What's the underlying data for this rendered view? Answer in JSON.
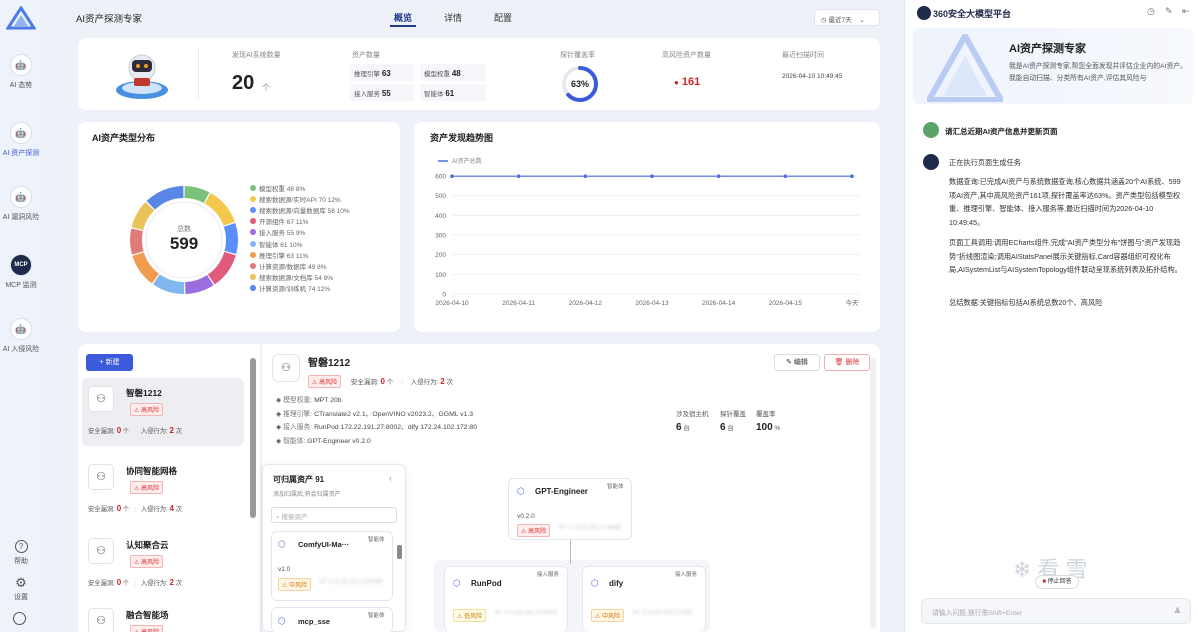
{
  "app": {
    "title": "AI资产探测专家"
  },
  "tabs": [
    {
      "label": "概览"
    },
    {
      "label": "详情"
    },
    {
      "label": "配置"
    }
  ],
  "time_filter": "最近7天",
  "nav": {
    "items": [
      {
        "label": "AI 态势"
      },
      {
        "label": "AI 资产探测"
      },
      {
        "label": "AI 漏洞风险"
      },
      {
        "label": "MCP 监测"
      },
      {
        "label": "AI 入侵风险"
      }
    ],
    "help": "帮助",
    "settings": "设置"
  },
  "stats": {
    "discovered_label": "发现AI系统数量",
    "discovered_value": "20",
    "discovered_unit": "个",
    "assets_label": "资产数量",
    "engine_label": "推理引擎",
    "engine_value": "63",
    "model_label": "模型权重",
    "model_value": "48",
    "access_label": "接入服务",
    "access_value": "55",
    "agent_label": "智能体",
    "agent_value": "61",
    "coverage_label": "探针覆盖率",
    "coverage_value": "63%",
    "coverage_fraction": 0.63,
    "high_risk_label": "高风险资产数量",
    "high_risk_value": "161",
    "scan_label": "最近扫描时间",
    "scan_value": "2026-04-10 10:49:45"
  },
  "donut": {
    "title": "AI资产类型分布",
    "center_label": "总数",
    "center_value": "599"
  },
  "trend": {
    "title": "资产发现趋势图"
  },
  "chart_data": [
    {
      "type": "pie",
      "title": "AI资产类型分布",
      "labels": [
        "模型权重 48 8%",
        "搜索数据源/实时API 70 12%",
        "搜索数据源/向量数据库 58 10%",
        "开源组件 67 11%",
        "接入服务 55 9%",
        "智能体 61 10%",
        "推理引擎 63 11%",
        "计算资源/数据库 49 8%",
        "搜索数据源/文档库 54 9%",
        "计算资源/训练机 74 12%"
      ],
      "values": [
        48,
        70,
        58,
        67,
        55,
        61,
        63,
        49,
        54,
        74
      ],
      "colors": [
        "#7ac17a",
        "#f2c94c",
        "#5b8ff9",
        "#e05a7b",
        "#9b6ee0",
        "#7fb8ef",
        "#f09b50",
        "#e07b7b",
        "#e8c35a",
        "#5a86e6"
      ]
    },
    {
      "type": "line",
      "title": "资产发现趋势图",
      "x": [
        "2026-04-10",
        "2026-04-11",
        "2026-04-12",
        "2026-04-13",
        "2026-04-14",
        "2026-04-15",
        "今天"
      ],
      "series": [
        {
          "name": "AI资产总数",
          "values": [
            599,
            599,
            599,
            599,
            599,
            599,
            599
          ]
        }
      ],
      "ylim": [
        0,
        600
      ],
      "yticks": [
        0,
        100,
        200,
        300,
        400,
        500,
        600
      ],
      "grid": true,
      "legend": "top-left"
    }
  ],
  "list": {
    "new_button": "新建",
    "vuln_label": "安全漏洞:",
    "intrusion_label": "入侵行为:",
    "times_unit": "次",
    "count_unit": "个",
    "items": [
      {
        "name": "智磐1212",
        "risk": "高风险",
        "vulns": "0",
        "intrusions": "2"
      },
      {
        "name": "协同智能网格",
        "risk": "高风险",
        "vulns": "0",
        "intrusions": "4"
      },
      {
        "name": "认知聚合云",
        "risk": "高风险",
        "vulns": "0",
        "intrusions": "2"
      },
      {
        "name": "融合智能场",
        "risk": "高风险"
      }
    ]
  },
  "detail": {
    "name": "智磐1212",
    "risk": "高风险",
    "vuln_label": "安全漏洞:",
    "vuln_value": "0",
    "vuln_unit": "个",
    "intr_label": "入侵行为:",
    "intr_value": "2",
    "intr_unit": "次",
    "edit": "编辑",
    "delete": "删除",
    "model_label": "模型权重:",
    "model_value": "MPT 20b",
    "engine_label": "推理引擎:",
    "engine_value": "CTranslate2 v2.1、OpenVINO v2023.2、GGML v1.3",
    "access_label": "接入服务:",
    "access_value": "RunPod 172.22.191.27:8002、dify 172.24.102.172:80",
    "agent_label": "智能体:",
    "agent_value": "GPT-Engineer v0.2.0",
    "hosts_label": "涉及宿主机",
    "hosts_value": "6",
    "hosts_unit": "台",
    "probe_label": "探针覆盖",
    "probe_value": "6",
    "probe_unit": "台",
    "cov_label": "覆盖率",
    "cov_value": "100",
    "cov_unit": "%"
  },
  "assign": {
    "title": "可归属资产 91",
    "subtitle": "添加归属后,将会归属资产",
    "search_placeholder": "搜索资产",
    "items": [
      {
        "name": "ComfyUI-Ma···",
        "tag": "智能体",
        "version": "v1.0",
        "risk": "中风险",
        "ip": "IP: 172.24.121.13:8188"
      },
      {
        "name": "mcp_sse",
        "tag": "智能体"
      }
    ]
  },
  "topo": {
    "nodes": [
      {
        "name": "GPT-Engineer",
        "tag": "智能体",
        "version": "v0.2.0",
        "risk": "高风险",
        "ip": "IP: 172.21.191.27:8888"
      },
      {
        "name": "RunPod",
        "tag": "接入服务",
        "risk": "低风险",
        "ip": "IP: 172.22.191.27:8002"
      },
      {
        "name": "dify",
        "tag": "接入服务",
        "risk": "中风险",
        "ip": "IP: 172.24.102.172:80"
      }
    ]
  },
  "panel": {
    "title": "360安全大模型平台",
    "hero_title": "AI资产探测专家",
    "hero_desc1": "我是AI资产探测专家,帮您全面发现并评估企业内的AI资产。",
    "hero_desc2": "我能自动扫描、分类所有AI资产,评估其风险与",
    "user_msg": "请汇总近期AI资产信息并更新页面",
    "status": "正在执行页面生成任务",
    "para1": "数据查询:已完成AI资产与系统数据查询,核心数据共涵盖20个AI系统、599项AI资产,其中高风险资产161项,探针覆盖率达63%。资产类型包括模型权重、推理引擎、智能体、接入服务等,最近扫描时间为2026-04-10 10:49:45。",
    "para2": "页面工具调用:调用ECharts组件,完成\"AI资产类型分布\"饼图与\"资产发现趋势\"折线图渲染;调用AIStatsPanel展示关键指标,Card容器组织可视化布局,AISystemList与AISystemTopology组件联动呈现系统列表及拓扑结构。",
    "para3": "总结数据:关键指标包括AI系统总数20个、高风险",
    "stop": "停止回答",
    "input_placeholder": "请输入问题,换行需Shift+Enter",
    "watermark": "看雪"
  }
}
